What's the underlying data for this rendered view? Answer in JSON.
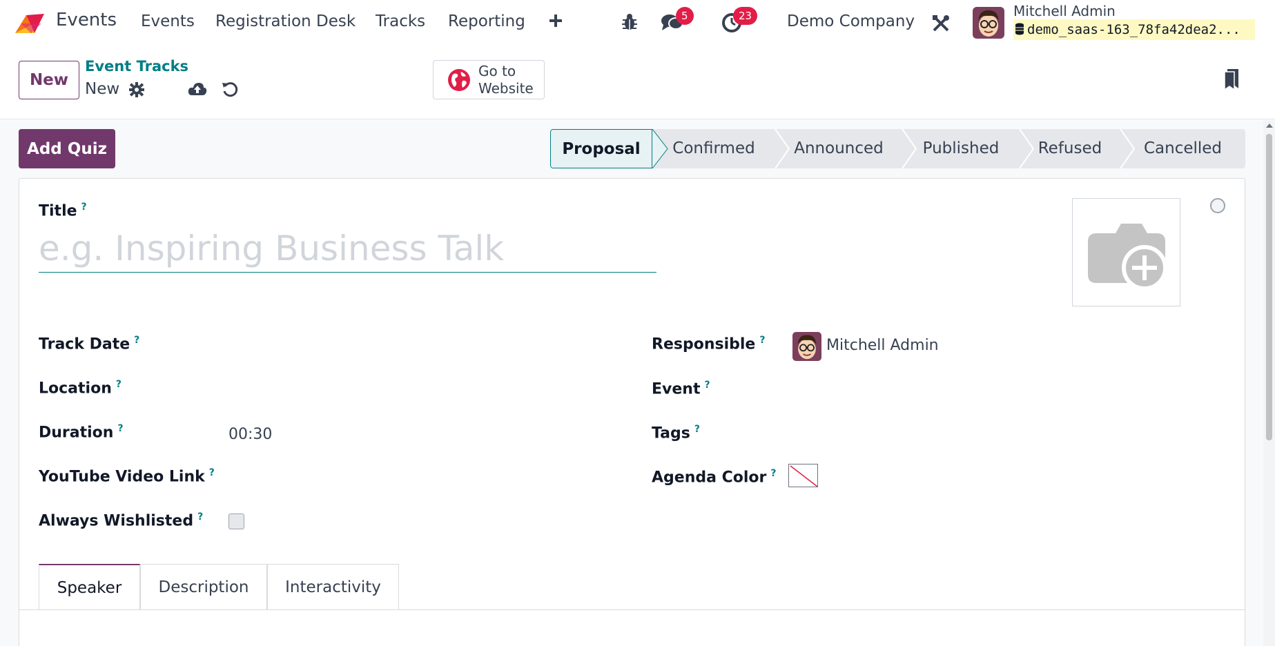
{
  "app": {
    "name": "Events"
  },
  "nav": {
    "menu": [
      "Events",
      "Registration Desk",
      "Tracks",
      "Reporting"
    ],
    "messages_count": "5",
    "activities_count": "23",
    "company": "Demo Company",
    "user_name": "Mitchell Admin",
    "database": "demo_saas-163_78fa42dea2..."
  },
  "control": {
    "new_label": "New",
    "breadcrumb": "Event Tracks",
    "record_name": "New",
    "website_line1": "Go to",
    "website_line2": "Website"
  },
  "form": {
    "add_quiz_label": "Add Quiz",
    "stages": [
      "Proposal",
      "Confirmed",
      "Announced",
      "Published",
      "Refused",
      "Cancelled"
    ],
    "active_stage": "Proposal",
    "title_label": "Title",
    "title_placeholder": "e.g. Inspiring Business Talk",
    "help_mark": "?",
    "left_fields": [
      {
        "label": "Track Date",
        "value": ""
      },
      {
        "label": "Location",
        "value": ""
      },
      {
        "label": "Duration",
        "value": "00:30"
      },
      {
        "label": "YouTube Video Link",
        "value": ""
      },
      {
        "label": "Always Wishlisted",
        "value": ""
      }
    ],
    "right_fields": [
      {
        "label": "Responsible",
        "value": "Mitchell Admin"
      },
      {
        "label": "Event",
        "value": ""
      },
      {
        "label": "Tags",
        "value": ""
      },
      {
        "label": "Agenda Color",
        "value": ""
      }
    ],
    "tabs": [
      "Speaker",
      "Description",
      "Interactivity"
    ]
  },
  "colors": {
    "brand": "#71396b",
    "accent": "#017e84",
    "badge": "#e11d48"
  }
}
